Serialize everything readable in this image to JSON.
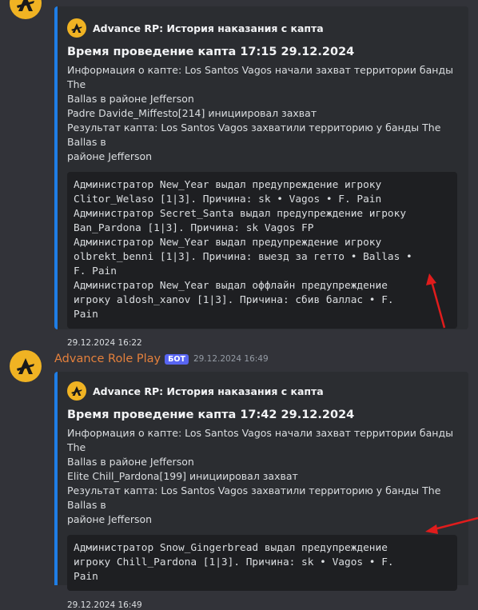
{
  "messages": [
    {
      "embed": {
        "author": "Advance RP: История наказания с капта",
        "title": "Время проведение капта 17:15 29.12.2024",
        "description": "Информация о капте: Los Santos Vagos начали захват территории банды The\nBallas в районе Jefferson\nPadre Davide_Miffesto[214] инициировал захват\nРезультат капта: Los Santos Vagos захватили территорию у банды The Ballas в\nрайоне Jefferson",
        "code": "Администратор New_Year выдал предупреждение игроку\nClitor_Welaso [1|3]. Причина: sk • Vagos • F. Pain\nАдминистратор Secret_Santa выдал предупреждение игроку\nBan_Pardona [1|3]. Причина: sk Vagos FP\nАдминистратор New_Year выдал предупреждение игроку\nolbrekt_benni [1|3]. Причина: выезд за гетто • Ballas •\nF. Pain\nАдминистратор New_Year выдал оффлайн предупреждение\nигроку aldosh_xanov [1|3]. Причина: сбив баллас • F.\nPain",
        "footer": "29.12.2024 16:22"
      }
    },
    {
      "username": "Advance Role Play",
      "bot_tag": "БОТ",
      "timestamp": "29.12.2024 16:49",
      "embed": {
        "author": "Advance RP: История наказания с капта",
        "title": "Время проведение капта 17:42 29.12.2024",
        "description": "Информация о капте: Los Santos Vagos начали захват территории банды The\nBallas в районе Jefferson\nElite Chill_Pardona[199] инициировал захват\nРезультат капта: Los Santos Vagos захватили территорию у банды The Ballas в\nрайоне Jefferson",
        "code": "Администратор Snow_Gingerbread выдал предупреждение\nигроку Chill_Pardona [1|3]. Причина: sk • Vagos • F.\nPain",
        "footer": "29.12.2024 16:49"
      }
    }
  ],
  "colors": {
    "accent": "#1f7ee6",
    "username": "#e4803c",
    "bot_tag": "#5865f2",
    "arrow": "#e01c1c",
    "avatar": "#f0b323"
  }
}
